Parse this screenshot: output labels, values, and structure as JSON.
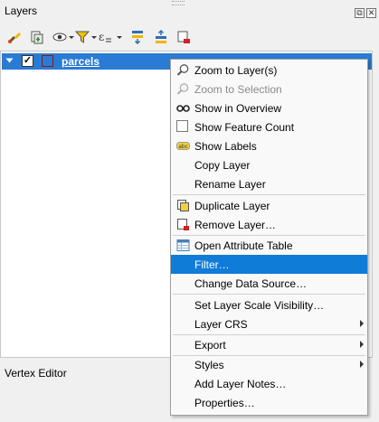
{
  "panel": {
    "title": "Layers",
    "float_icon": "⧉",
    "close_icon": "✕",
    "toolbar": [
      "style-brush-icon",
      "add-group-icon",
      "visibility-icon",
      "filter-legend-icon",
      "expression-filter-icon",
      "expand-all-icon",
      "collapse-all-icon",
      "remove-layer-icon"
    ]
  },
  "layer": {
    "name": "parcels",
    "checked_mark": "✓"
  },
  "vertex_editor": {
    "title": "Vertex Editor"
  },
  "menu": {
    "items": [
      {
        "label": "Zoom to Layer(s)",
        "icon": "zoom-layer-icon",
        "enabled": true
      },
      {
        "label": "Zoom to Selection",
        "icon": "zoom-selection-icon",
        "enabled": false
      },
      {
        "label": "Show in Overview",
        "icon": "overview-glasses-icon",
        "enabled": true
      },
      {
        "label": "Show Feature Count",
        "icon": "checkbox",
        "enabled": true
      },
      {
        "label": "Show Labels",
        "icon": "labels-abc-icon",
        "enabled": true
      },
      {
        "label": "Copy Layer",
        "icon": "",
        "enabled": true
      },
      {
        "label": "Rename Layer",
        "icon": "",
        "enabled": true
      },
      {
        "label": "Duplicate Layer",
        "icon": "duplicate-layer-icon",
        "enabled": true
      },
      {
        "label": "Remove Layer…",
        "icon": "remove-layer-icon",
        "enabled": true
      },
      {
        "label": "Open Attribute Table",
        "icon": "attribute-table-icon",
        "enabled": true
      },
      {
        "label": "Filter…",
        "icon": "",
        "enabled": true,
        "highlighted": true
      },
      {
        "label": "Change Data Source…",
        "icon": "",
        "enabled": true
      },
      {
        "label": "Set Layer Scale Visibility…",
        "icon": "",
        "enabled": true
      },
      {
        "label": "Layer CRS",
        "icon": "",
        "enabled": true,
        "submenu": true
      },
      {
        "label": "Export",
        "icon": "",
        "enabled": true,
        "submenu": true
      },
      {
        "label": "Styles",
        "icon": "",
        "enabled": true,
        "submenu": true
      },
      {
        "label": "Add Layer Notes…",
        "icon": "",
        "enabled": true
      },
      {
        "label": "Properties…",
        "icon": "",
        "enabled": true
      }
    ]
  },
  "colors": {
    "selection": "#2a7bd3",
    "menu_highlight": "#0f7cd8"
  }
}
